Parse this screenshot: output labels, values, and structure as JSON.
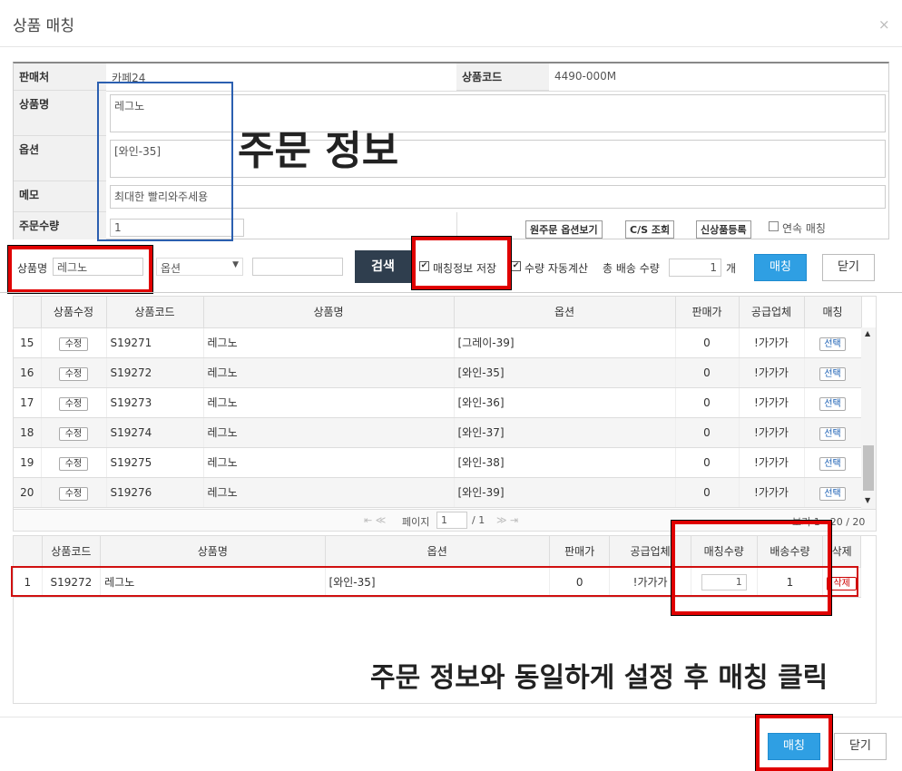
{
  "dialog": {
    "title": "상품 매칭"
  },
  "order_info": {
    "seller_label": "판매처",
    "seller_value": "카페24",
    "code_label": "상품코드",
    "code_value": "4490-000M",
    "name_label": "상품명",
    "name_value": "레그노",
    "option_label": "옵션",
    "option_value": "[와인-35]",
    "memo_label": "메모",
    "memo_value": "최대한 빨리와주세용",
    "qty_label": "주문수량",
    "qty_value": "1",
    "btn_orig_option": "원주문 옵션보기",
    "btn_cs": "C/S 조회",
    "btn_new_product": "신상품등록",
    "chk_continuous": "연속 매칭"
  },
  "annotations": {
    "order_info": "주문 정보",
    "instruction": "주문 정보와 동일하게 설정 후 매칭 클릭"
  },
  "search": {
    "name_label": "상품명",
    "name_value": "레그노",
    "option_select": "옵션",
    "search_btn": "검색",
    "chk_save": "매칭정보 저장",
    "chk_auto": "수량 자동계산",
    "total_label": "총 배송 수량",
    "total_value": "1",
    "unit": "개",
    "match_btn": "매칭",
    "close_btn": "닫기"
  },
  "results": {
    "headers": [
      "",
      "상품수정",
      "상품코드",
      "상품명",
      "옵션",
      "판매가",
      "공급업체",
      "매칭"
    ],
    "edit_label": "수정",
    "select_label": "선택",
    "rows": [
      {
        "no": "15",
        "code": "S19271",
        "name": "레그노",
        "option": "[그레이-39]",
        "price": "0",
        "supplier": "!가가가"
      },
      {
        "no": "16",
        "code": "S19272",
        "name": "레그노",
        "option": "[와인-35]",
        "price": "0",
        "supplier": "!가가가"
      },
      {
        "no": "17",
        "code": "S19273",
        "name": "레그노",
        "option": "[와인-36]",
        "price": "0",
        "supplier": "!가가가"
      },
      {
        "no": "18",
        "code": "S19274",
        "name": "레그노",
        "option": "[와인-37]",
        "price": "0",
        "supplier": "!가가가"
      },
      {
        "no": "19",
        "code": "S19275",
        "name": "레그노",
        "option": "[와인-38]",
        "price": "0",
        "supplier": "!가가가"
      },
      {
        "no": "20",
        "code": "S19276",
        "name": "레그노",
        "option": "[와인-39]",
        "price": "0",
        "supplier": "!가가가"
      }
    ],
    "pager": {
      "page_label": "페이지",
      "page_value": "1",
      "page_total": "/ 1",
      "range": "보기 1 - 20 / 20"
    }
  },
  "matched": {
    "headers": [
      "",
      "상품코드",
      "상품명",
      "옵션",
      "판매가",
      "공급업체",
      "매칭수량",
      "배송수량",
      "삭제"
    ],
    "row": {
      "no": "1",
      "code": "S19272",
      "name": "레그노",
      "option": "[와인-35]",
      "price": "0",
      "supplier": "!가가가",
      "match_qty": "1",
      "ship_qty": "1",
      "delete": "삭제"
    }
  },
  "footer": {
    "match_btn": "매칭",
    "close_btn": "닫기"
  }
}
